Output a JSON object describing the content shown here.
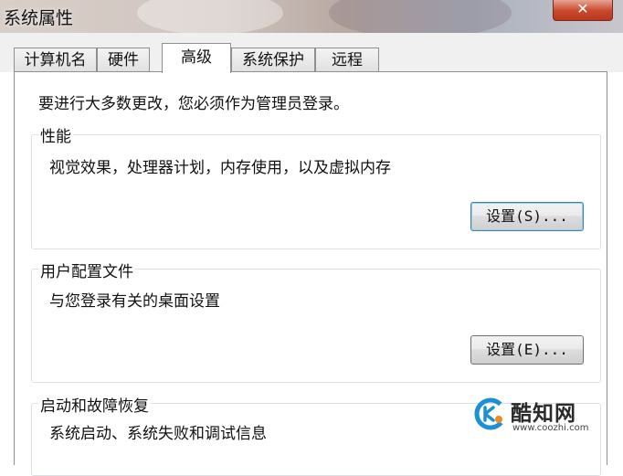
{
  "window": {
    "title": "系统属性",
    "close_glyph": "✕"
  },
  "tabs": [
    {
      "label": "计算机名",
      "active": false
    },
    {
      "label": "硬件",
      "active": false
    },
    {
      "label": "高级",
      "active": true
    },
    {
      "label": "系统保护",
      "active": false
    },
    {
      "label": "远程",
      "active": false
    }
  ],
  "main": {
    "admin_notice": "要进行大多数更改，您必须作为管理员登录。",
    "performance": {
      "legend": "性能",
      "description": "视觉效果，处理器计划，内存使用，以及虚拟内存",
      "button_label": "设置(S)..."
    },
    "user_profiles": {
      "legend": "用户配置文件",
      "description": "与您登录有关的桌面设置",
      "button_label": "设置(E)..."
    },
    "startup_recovery": {
      "legend": "启动和故障恢复",
      "description": "系统启动、系统失败和调试信息"
    }
  },
  "watermark": {
    "title": "酷知网",
    "url": "www.coozhi.com",
    "icon": "coozhi-logo-icon"
  },
  "colors": {
    "focus_border": "#3c7fb1",
    "close_button": "#c9472b",
    "logo_blue": "#1d8fd6",
    "logo_orange": "#f08a1c"
  }
}
